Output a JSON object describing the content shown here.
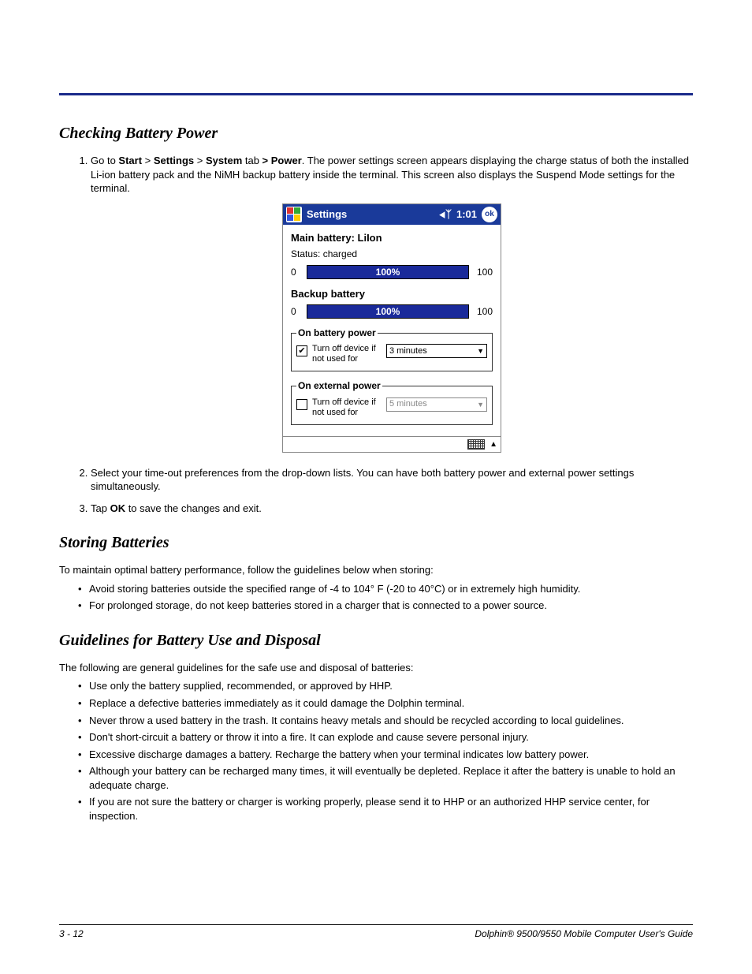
{
  "sections": {
    "checking": {
      "title": "Checking Battery Power",
      "step1_pre": "Go to ",
      "step1_b1": "Start",
      "step1_sep": " > ",
      "step1_b2": "Settings",
      "step1_b3": "System",
      "step1_tab": " tab ",
      "step1_b4": "> Power",
      "step1_post": ". The power settings screen appears displaying the charge status of both the installed Li-ion battery pack and the NiMH backup battery inside the terminal. This screen also displays the Suspend Mode settings for the terminal.",
      "step2": "Select your time-out preferences from the drop-down lists. You can have both battery power and external power settings simultaneously.",
      "step3_pre": "Tap ",
      "step3_b": "OK",
      "step3_post": " to save the changes and exit."
    },
    "storing": {
      "title": "Storing Batteries",
      "intro": "To maintain optimal battery performance, follow the guidelines below when storing:",
      "b1": "Avoid storing batteries outside the specified range of -4 to 104° F (-20 to 40°C) or in extremely high humidity.",
      "b2": "For prolonged storage, do not keep batteries stored in a charger that is connected to a power source."
    },
    "guidelines": {
      "title": "Guidelines for Battery Use and Disposal",
      "intro": "The following are general guidelines for the safe use and disposal of batteries:",
      "b1": "Use only the battery supplied, recommended, or approved by HHP.",
      "b2": "Replace a defective batteries immediately as it could damage the Dolphin terminal.",
      "b3": "Never throw a used battery in the trash. It contains heavy metals and should be recycled according to local guidelines.",
      "b4": "Don't short-circuit a battery or throw it into a fire. It can explode and cause severe personal injury.",
      "b5": "Excessive discharge damages a battery. Recharge the battery when your terminal indicates low battery power.",
      "b6": "Although your battery can be recharged many times, it will eventually be depleted. Replace it after the battery is unable to hold an adequate charge.",
      "b7": "If you are not sure the battery or charger is working properly, please send it to HHP or an authorized HHP service center, for inspection."
    }
  },
  "screenshot": {
    "title": "Settings",
    "time": "1:01",
    "ok": "ok",
    "main_label": "Main battery: LiIon",
    "status": "Status: charged",
    "zero": "0",
    "hundred": "100",
    "pct": "100%",
    "backup_label": "Backup battery",
    "grp1": {
      "legend": "On battery power",
      "cb_label": "Turn off device if not used for",
      "dd": "3 minutes"
    },
    "grp2": {
      "legend": "On external power",
      "cb_label": "Turn off device if not used for",
      "dd": "5 minutes"
    }
  },
  "footer": {
    "page": "3 - 12",
    "book": "Dolphin® 9500/9550 Mobile Computer User's Guide"
  }
}
